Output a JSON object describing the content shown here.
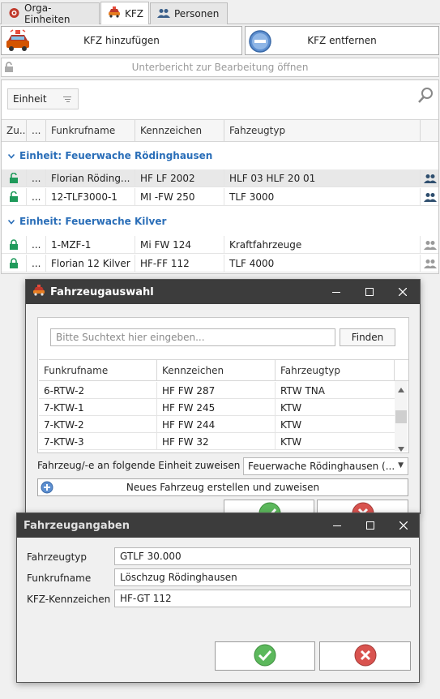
{
  "tabs": [
    {
      "label": "Orga-Einheiten",
      "icon": "org-icon"
    },
    {
      "label": "KFZ",
      "icon": "car-icon",
      "active": true
    },
    {
      "label": "Personen",
      "icon": "people-icon"
    }
  ],
  "toolbar": {
    "add_label": "KFZ hinzufügen",
    "remove_label": "KFZ entfernen",
    "subreport_label": "Unterbericht zur Bearbeitung öffnen"
  },
  "grid": {
    "group_button_label": "Einheit",
    "columns": [
      "Zu...",
      "...",
      "Funkrufname",
      "Kennzeichen",
      "Fahzeugtyp"
    ],
    "groups": [
      {
        "title": "Einheit: Feuerwache Rödinghausen",
        "rows": [
          {
            "lock": "unlocked",
            "dots": "...",
            "funkrufname": "Florian Röding...",
            "kennzeichen": "HF LF 2002",
            "typ": "HLF 03 HLF 20 01",
            "selected": true
          },
          {
            "lock": "unlocked",
            "dots": "...",
            "funkrufname": "12-TLF3000-1",
            "kennzeichen": "MI -FW 250",
            "typ": "TLF 3000",
            "selected": false
          }
        ]
      },
      {
        "title": "Einheit: Feuerwache Kilver",
        "rows": [
          {
            "lock": "locked",
            "dots": "...",
            "funkrufname": "1-MZF-1",
            "kennzeichen": "Mi FW 124",
            "typ": "Kraftfahrzeuge",
            "selected": false
          },
          {
            "lock": "locked",
            "dots": "...",
            "funkrufname": "Florian 12 Kilver",
            "kennzeichen": "HF-FF 112",
            "typ": "TLF 4000",
            "selected": false
          }
        ]
      }
    ]
  },
  "vehicle_dialog": {
    "title": "Fahrzeugauswahl",
    "search_placeholder": "Bitte Suchtext hier eingeben...",
    "find_label": "Finden",
    "columns": [
      "Funkrufname",
      "Kennzeichen",
      "Fahrzeugtyp"
    ],
    "rows": [
      [
        "6-RTW-2",
        "HF FW 287",
        "RTW TNA"
      ],
      [
        "7-KTW-1",
        "HF FW 245",
        "KTW"
      ],
      [
        "7-KTW-2",
        "HF FW 244",
        "KTW"
      ],
      [
        "7-KTW-3",
        "HF FW 32",
        "KTW"
      ]
    ],
    "assign_label": "Fahrzeug/-e an folgende Einheit zuweisen",
    "assign_value": "Feuerwache Rödinghausen (...",
    "create_label": "Neues Fahrzeug erstellen und zuweisen"
  },
  "details_dialog": {
    "title": "Fahrzeugangaben",
    "fields": [
      {
        "label": "Fahrzeugtyp",
        "value": "GTLF 30.000"
      },
      {
        "label": "Funkrufname",
        "value": "Löschzug Rödinghausen"
      },
      {
        "label": "KFZ-Kennzeichen",
        "value": "HF-GT 112"
      }
    ]
  },
  "colors": {
    "accent_blue": "#2a6eb8",
    "lock_green": "#1f9a5b",
    "titlebar": "#3c3c3c"
  }
}
